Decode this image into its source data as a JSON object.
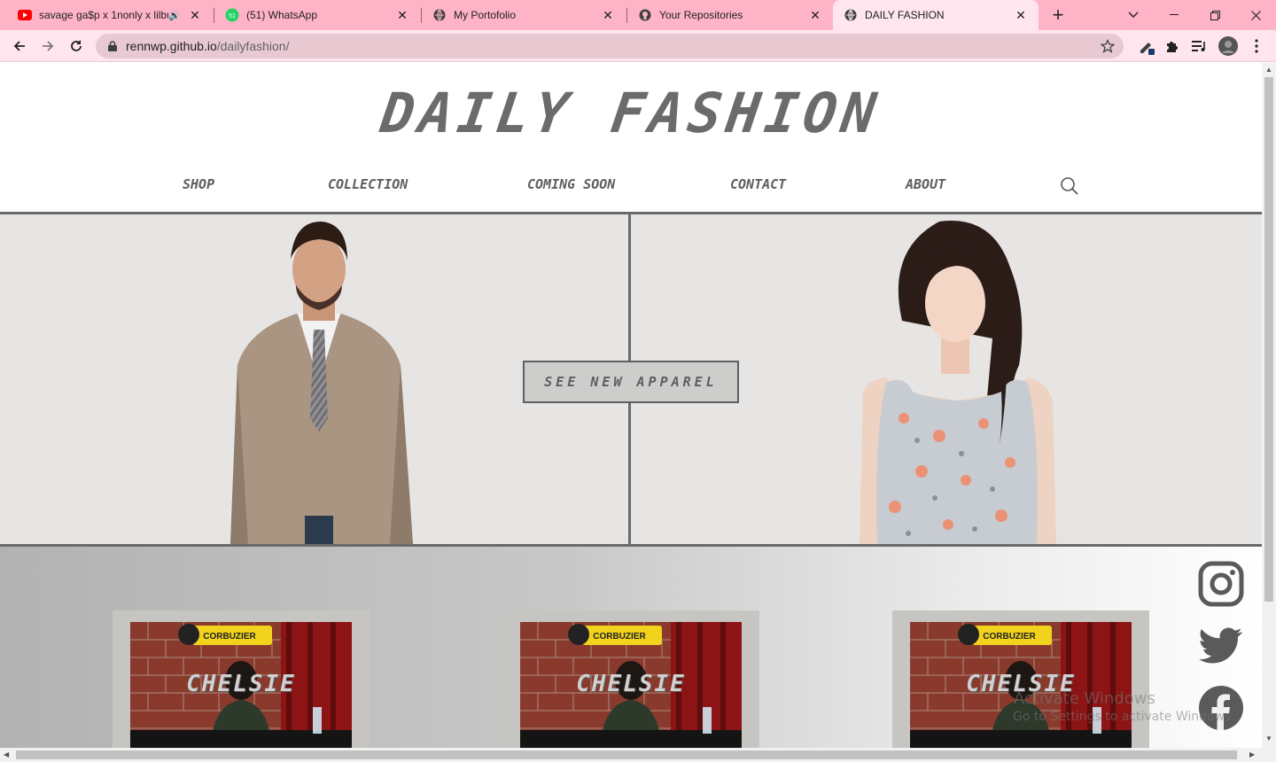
{
  "browser": {
    "tabs": [
      {
        "title": "savage ga$p x 1nonly x lilbu",
        "icon": "youtube-icon",
        "audio": true
      },
      {
        "title": "(51) WhatsApp",
        "icon": "whatsapp-icon"
      },
      {
        "title": "My Portofolio",
        "icon": "globe-icon"
      },
      {
        "title": "Your Repositories",
        "icon": "github-icon"
      },
      {
        "title": "DAILY FASHION",
        "icon": "globe-icon",
        "active": true
      }
    ],
    "url_host": "rennwp.github.io",
    "url_path": "/dailyfashion/",
    "theme_color": "#ffb3c7"
  },
  "site": {
    "brand": "DAILY FASHION",
    "nav": [
      "SHOP",
      "COLLECTION",
      "COMING SOON",
      "CONTACT",
      "ABOUT"
    ],
    "cta": "SEE NEW APPAREL",
    "cards": [
      {
        "label": "CHELSIE",
        "podcast": "CORBUZIER"
      },
      {
        "label": "CHELSIE",
        "podcast": "CORBUZIER"
      },
      {
        "label": "CHELSIE",
        "podcast": "CORBUZIER"
      }
    ],
    "social": [
      "instagram-icon",
      "twitter-icon",
      "facebook-icon"
    ]
  },
  "watermark": {
    "line1": "Activate Windows",
    "line2": "Go to Settings to activate Windows."
  }
}
